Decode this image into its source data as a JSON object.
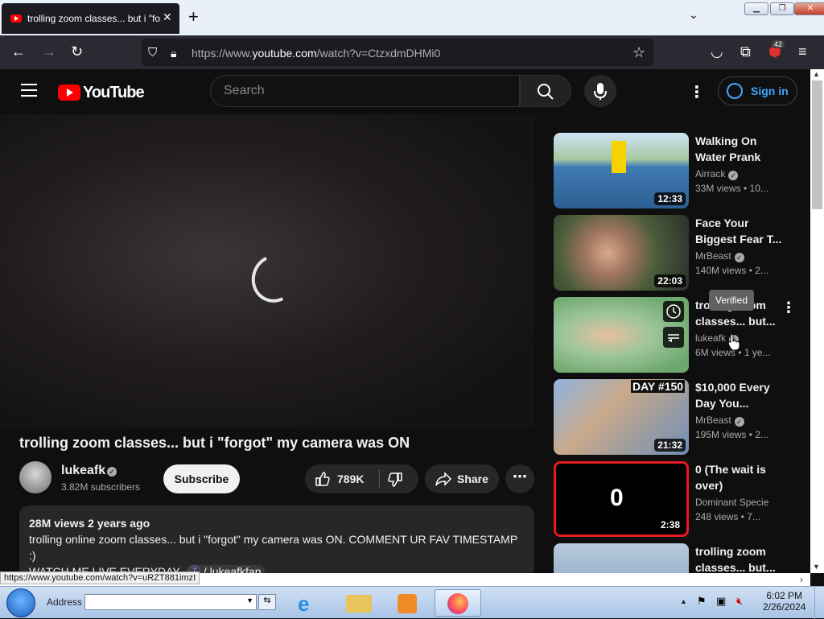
{
  "browser": {
    "tab_title": "trolling zoom classes... but i \"fo",
    "tab_close": "✕",
    "new_tab": "+",
    "url_prefix": "https://www.",
    "url_domain": "youtube.com",
    "url_rest": "/watch?v=CtzxdmDHMi0",
    "extension_badge": "42"
  },
  "yt": {
    "logo_text": "YouTube",
    "search_placeholder": "Search",
    "sign_in": "Sign in"
  },
  "video": {
    "title": "trolling zoom classes... but i \"forgot\" my camera was ON",
    "channel": "lukeafk",
    "subscribers": "3.82M subscribers",
    "subscribe": "Subscribe",
    "likes": "789K",
    "share": "Share",
    "views_date": "28M views  2 years ago",
    "desc_line1": "trolling online zoom classes... but i \"forgot\" my camera was ON. COMMENT UR FAV TIMESTAMP :)",
    "desc_line2_prefix": "WATCH ME LIVE EVERYDAY- ",
    "desc_line2_link": "/ lukeafkfan"
  },
  "recommendations": [
    {
      "title": "Walking On Water Prank",
      "channel": "Airrack",
      "meta": "33M views  • 10...",
      "duration": "12:33",
      "thumb_color": "#3a6f9c"
    },
    {
      "title": "Face Your Biggest Fear T...",
      "channel": "MrBeast",
      "meta": "140M views  • 2...",
      "duration": "22:03",
      "thumb_color": "#5d6b4a"
    },
    {
      "title": "trolling zoom classes... but...",
      "channel": "lukeafk",
      "meta": "6M views  • 1 ye...",
      "duration": "",
      "thumb_color": "#8fb88f"
    },
    {
      "title": "$10,000 Every Day You...",
      "channel": "MrBeast",
      "meta": "195M views  • 2...",
      "duration": "21:32",
      "thumb_color": "#6a8cb5"
    },
    {
      "title": "0 (The wait is over)",
      "channel": "Dominant Specie",
      "meta": "248 views  • 7...",
      "duration": "2:38",
      "thumb_color": "#000000",
      "thumb_label": "0"
    },
    {
      "title": "trolling zoom classes... but...",
      "channel": "",
      "meta": "",
      "duration": "",
      "thumb_color": "#7a9abc"
    }
  ],
  "tooltip": "Verified",
  "thumb_texts": {
    "day150": "DAY #150"
  },
  "status_link": "https://www.youtube.com/watch?v=uRZT881imzI",
  "taskbar": {
    "address_label": "Address",
    "time": "6:02 PM",
    "date": "2/26/2024"
  }
}
